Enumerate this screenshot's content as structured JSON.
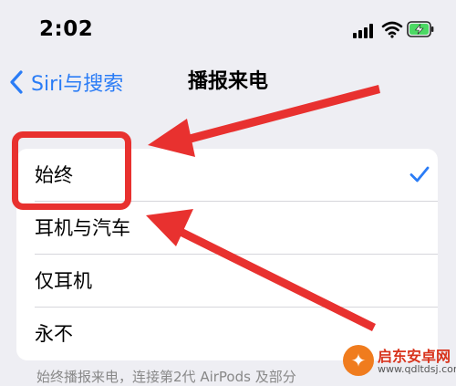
{
  "status_bar": {
    "time": "2:02",
    "icons": [
      "cellular-signal-icon",
      "wifi-icon",
      "battery-charging-icon"
    ],
    "battery_color": "#4cd964"
  },
  "nav": {
    "back_label": "Siri与搜索",
    "title": "播报来电",
    "accent_color": "#2a7cf6"
  },
  "options": [
    {
      "label": "始终",
      "selected": true
    },
    {
      "label": "耳机与汽车",
      "selected": false
    },
    {
      "label": "仅耳机",
      "selected": false
    },
    {
      "label": "永不",
      "selected": false
    }
  ],
  "footer_note": "始终播报来电，连接第2代 AirPods 及部分",
  "annotation": {
    "color": "#e8312f",
    "highlight_target": "始终",
    "arrow_targets": [
      "始终",
      "耳机与汽车"
    ]
  },
  "watermark": {
    "name": "启东安卓网",
    "url": "www.qdltdsj.com",
    "badge_color": "#f07c1e"
  }
}
